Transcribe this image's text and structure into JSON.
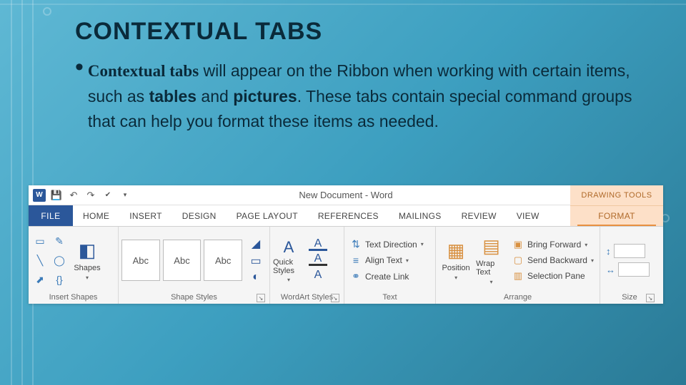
{
  "slide": {
    "title": "CONTEXTUAL TABS",
    "bullet_lead": "Contextual tabs",
    "bullet_mid1": " will appear on the Ribbon when working with certain items, such as ",
    "bullet_bold1": "tables",
    "bullet_mid2": " and ",
    "bullet_bold2": "pictures",
    "bullet_tail": ". These tabs contain special command groups that can help you format these items as needed."
  },
  "ribbon": {
    "doc_title": "New Document - Word",
    "context_header": "DRAWING TOOLS",
    "tabs": {
      "file": "FILE",
      "home": "HOME",
      "insert": "INSERT",
      "design": "DESIGN",
      "page_layout": "PAGE LAYOUT",
      "references": "REFERENCES",
      "mailings": "MAILINGS",
      "review": "REVIEW",
      "view": "VIEW",
      "format": "FORMAT"
    },
    "groups": {
      "insert_shapes": {
        "label": "Insert Shapes",
        "shapes_button": "Shapes"
      },
      "shape_styles": {
        "label": "Shape Styles",
        "preview_text": "Abc"
      },
      "wordart_styles": {
        "label": "WordArt Styles",
        "quick_styles": "Quick Styles"
      },
      "text": {
        "label": "Text",
        "text_direction": "Text Direction",
        "align_text": "Align Text",
        "create_link": "Create Link"
      },
      "arrange": {
        "label": "Arrange",
        "position": "Position",
        "wrap_text": "Wrap Text",
        "bring_forward": "Bring Forward",
        "send_backward": "Send Backward",
        "selection_pane": "Selection Pane"
      },
      "size": {
        "label": "Size"
      }
    }
  }
}
